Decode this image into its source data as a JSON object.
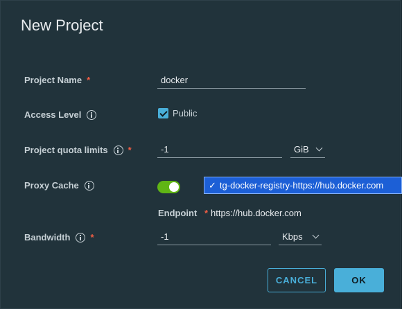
{
  "dialog": {
    "title": "New Project"
  },
  "fields": {
    "project_name": {
      "label": "Project Name",
      "value": "docker"
    },
    "access_level": {
      "label": "Access Level",
      "checkbox_label": "Public",
      "checked": true
    },
    "quota": {
      "label": "Project quota limits",
      "value": "-1",
      "unit": "GiB"
    },
    "proxy_cache": {
      "label": "Proxy Cache",
      "enabled": true,
      "selected_registry": "tg-docker-registry-https://hub.docker.com",
      "selected_mark": "✓"
    },
    "endpoint": {
      "label": "Endpoint",
      "value": "https://hub.docker.com"
    },
    "bandwidth": {
      "label": "Bandwidth",
      "value": "-1",
      "unit": "Kbps"
    }
  },
  "required_mark": "*",
  "buttons": {
    "cancel": "CANCEL",
    "ok": "OK"
  },
  "colors": {
    "background": "#21333b",
    "accent": "#49afd9",
    "toggle_on": "#60b515",
    "required": "#f35e44",
    "dropdown_highlight": "#1c5fd6"
  }
}
